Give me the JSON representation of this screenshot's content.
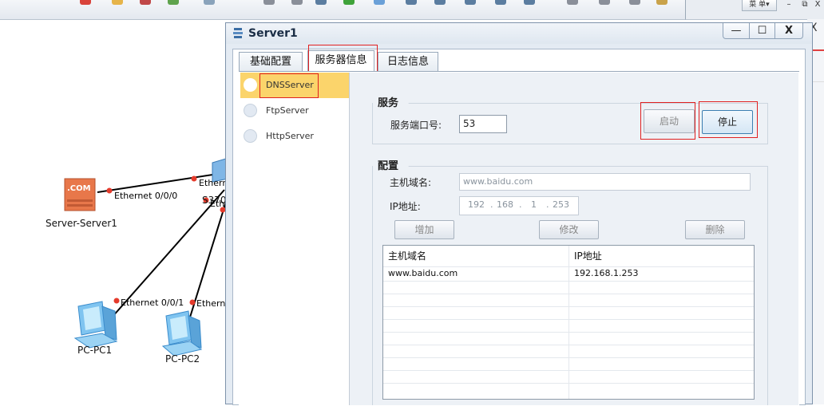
{
  "window": {
    "title": "Server1",
    "min_glyph": "—",
    "max_glyph": "☐",
    "close_glyph": "X"
  },
  "outer": {
    "menu_label": "菜 单▾",
    "min": "–",
    "max": "⧉",
    "close": "X",
    "panel_close": "X"
  },
  "tabs": [
    {
      "label": "基础配置"
    },
    {
      "label": "服务器信息"
    },
    {
      "label": "日志信息"
    }
  ],
  "servers": [
    {
      "label": "DNSServer",
      "selected": true
    },
    {
      "label": "FtpServer",
      "selected": false
    },
    {
      "label": "HttpServer",
      "selected": false
    }
  ],
  "service": {
    "title": "服务",
    "port_label": "服务端口号:",
    "port_value": "53",
    "start_label": "启动",
    "stop_label": "停止"
  },
  "config": {
    "title": "配置",
    "host_label": "主机域名:",
    "host_value": "www.baidu.com",
    "ip_label": "IP地址:",
    "ip_octets": [
      "192",
      "168",
      "1",
      "253"
    ],
    "ip_dot": ".",
    "add_label": "增加",
    "modify_label": "修改",
    "delete_label": "删除"
  },
  "table": {
    "headers": [
      "主机域名",
      "IP地址"
    ],
    "rows": [
      [
        "www.baidu.com",
        "192.168.1.253"
      ]
    ]
  },
  "topology": {
    "labels": {
      "server_port": "Ethernet 0/0/0",
      "switch_port_top": "Ethern",
      "switch_name": "S370",
      "switch_port_mid": "Eth",
      "pc1_port": "Ethernet 0/0/1",
      "pc2_port": "Etherne"
    },
    "devices": {
      "server": "Server-Server1",
      "server_badge": ".COM",
      "pc1": "PC-PC1",
      "pc2": "PC-PC2"
    }
  },
  "colors": {
    "accent": "#fbd46b",
    "highlight_box": "#e02020",
    "link_dot": "#e53b2c"
  }
}
